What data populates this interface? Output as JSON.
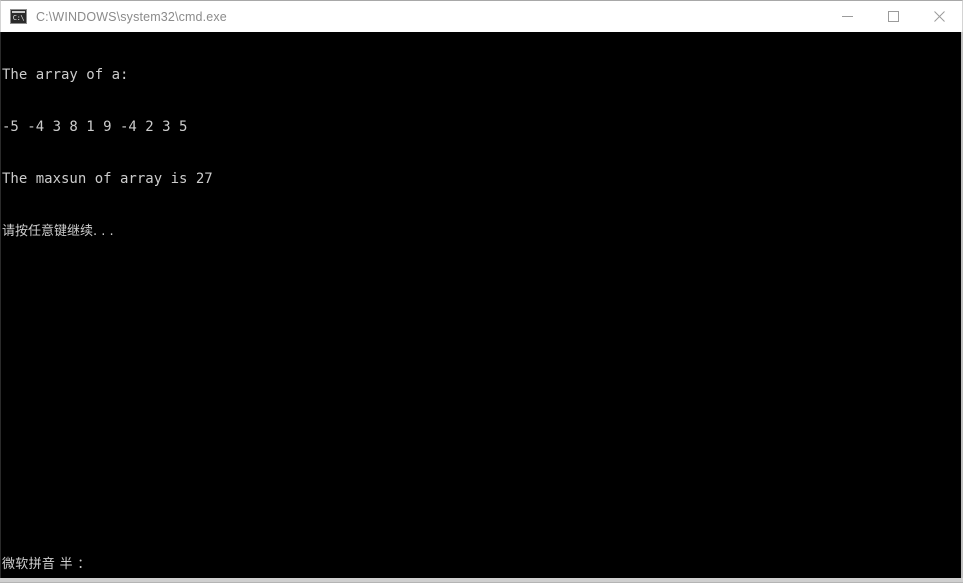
{
  "window": {
    "title": "C:\\WINDOWS\\system32\\cmd.exe",
    "icon_name": "cmd-icon",
    "icon_glyph": "C:\\",
    "colors": {
      "titlebar_background": "#ffffff",
      "titlebar_text": "#8b8b8b",
      "console_background": "#000000",
      "console_text": "#cccccc",
      "window_border": "#c0c0c0"
    },
    "controls": [
      {
        "name": "minimize",
        "label": "Minimize"
      },
      {
        "name": "maximize",
        "label": "Maximize"
      },
      {
        "name": "close",
        "label": "Close"
      }
    ]
  },
  "console": {
    "lines": [
      "The array of a:",
      "-5 -4 3 8 1 9 -4 2 3 5",
      "The maxsun of array is 27",
      "请按任意键继续. . ."
    ],
    "line_0": "The array of a:",
    "line_1": "-5 -4 3 8 1 9 -4 2 3 5",
    "line_2": "The maxsun of array is 27",
    "line_3": "请按任意键继续. . ."
  },
  "ime": {
    "status_text": "微软拼音 半 ："
  }
}
